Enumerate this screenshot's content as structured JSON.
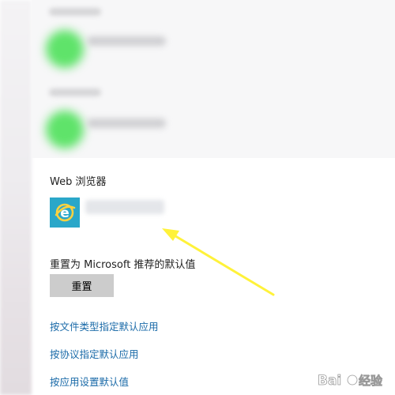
{
  "browser_section": {
    "title": "Web 浏览器",
    "app_icon": "internet-explorer-icon"
  },
  "reset": {
    "label": "重置为 Microsoft 推荐的默认值",
    "button_label": "重置"
  },
  "links": [
    {
      "label": "按文件类型指定默认应用"
    },
    {
      "label": "按协议指定默认应用"
    },
    {
      "label": "按应用设置默认值"
    }
  ],
  "annotation": {
    "arrow_color": "#fff23a"
  },
  "colors": {
    "link": "#1a6aa8",
    "button_bg": "#cccccc",
    "blurred_app_icon": "#5fe36a",
    "ie_tile": "#2aa7c9"
  },
  "watermark": {
    "text": "Bai经验"
  }
}
